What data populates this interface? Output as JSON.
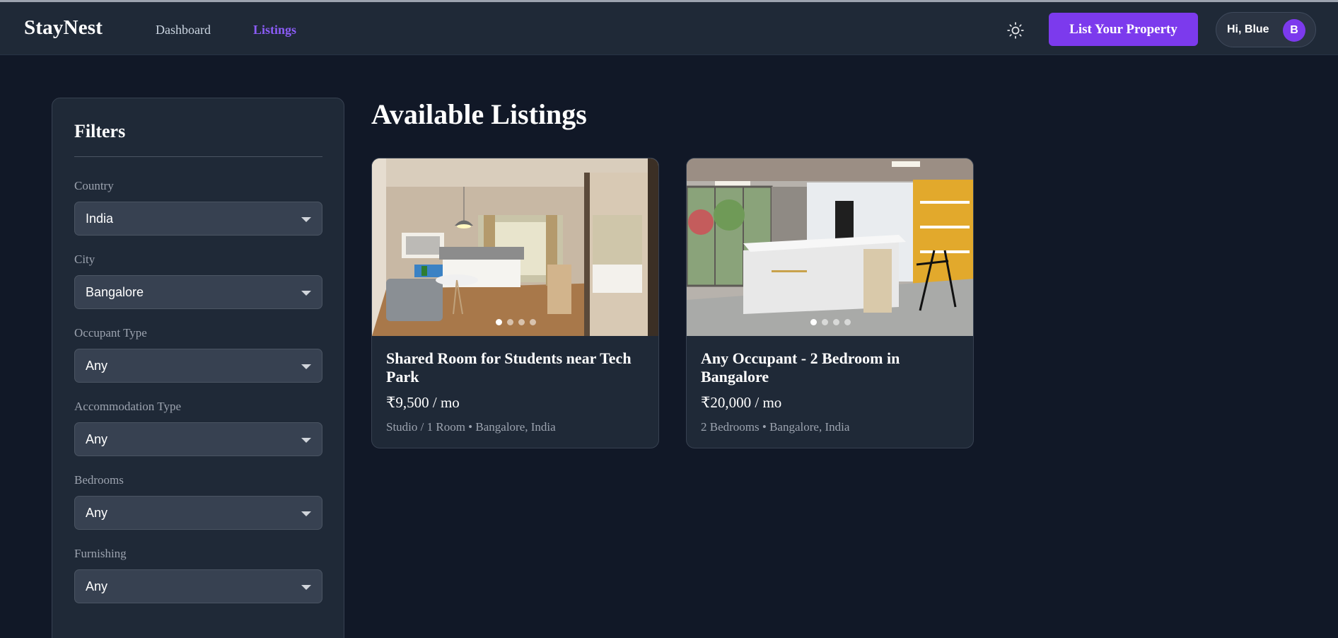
{
  "header": {
    "brand": "StayNest",
    "nav": [
      {
        "label": "Dashboard",
        "active": false
      },
      {
        "label": "Listings",
        "active": true
      }
    ],
    "theme_icon": "sun-icon",
    "cta_label": "List Your Property",
    "user_greeting": "Hi, Blue",
    "avatar_initial": "B"
  },
  "filters": {
    "title": "Filters",
    "fields": [
      {
        "label": "Country",
        "value": "India"
      },
      {
        "label": "City",
        "value": "Bangalore"
      },
      {
        "label": "Occupant Type",
        "value": "Any"
      },
      {
        "label": "Accommodation Type",
        "value": "Any"
      },
      {
        "label": "Bedrooms",
        "value": "Any"
      },
      {
        "label": "Furnishing",
        "value": "Any"
      }
    ]
  },
  "main": {
    "title": "Available Listings",
    "listings": [
      {
        "title": "Shared Room for Students near Tech Park",
        "price": "₹9,500 / mo",
        "meta": "Studio / 1 Room • Bangalore, India",
        "image": "bedroom-photo",
        "image_count": 4,
        "active_image": 1
      },
      {
        "title": "Any Occupant - 2 Bedroom in Bangalore",
        "price": "₹20,000 / mo",
        "meta": "2 Bedrooms • Bangalore, India",
        "image": "kitchen-photo",
        "image_count": 4,
        "active_image": 1
      }
    ]
  },
  "colors": {
    "background": "#111827",
    "surface": "#1f2937",
    "accent": "#7c3aed",
    "accent_text": "#8b5cf6",
    "muted": "#9ca3af"
  }
}
